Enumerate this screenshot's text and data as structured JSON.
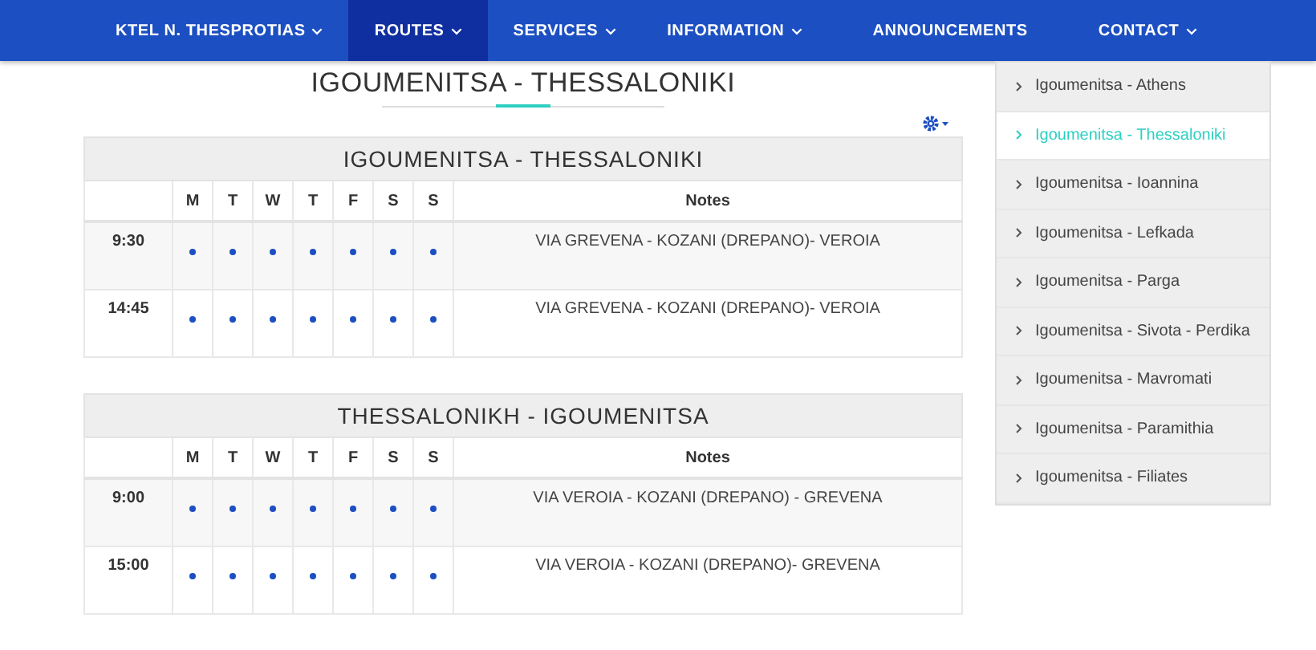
{
  "nav": [
    {
      "label": "KTEL N. THESPROTIAS",
      "dropdown": true,
      "selected": false
    },
    {
      "label": "ROUTES",
      "dropdown": true,
      "selected": true
    },
    {
      "label": "SERVICES",
      "dropdown": true,
      "selected": false
    },
    {
      "label": "INFORMATION",
      "dropdown": true,
      "selected": false
    },
    {
      "label": "ANNOUNCEMENTS",
      "dropdown": false,
      "selected": false
    },
    {
      "label": "CONTACT",
      "dropdown": true,
      "selected": false
    }
  ],
  "page_title": "IGOUMENITSA - THESSALONIKI",
  "timetables": [
    {
      "title": "IGOUMENITSA - THESSALONIKI",
      "days": [
        "M",
        "T",
        "W",
        "T",
        "F",
        "S",
        "S"
      ],
      "notes_header": "Notes",
      "rows": [
        {
          "time": "9:30",
          "runs": [
            true,
            true,
            true,
            true,
            true,
            true,
            true
          ],
          "notes": "VIA GREVENA - KOZANI (DREPANO)- VEROIA"
        },
        {
          "time": "14:45",
          "runs": [
            true,
            true,
            true,
            true,
            true,
            true,
            true
          ],
          "notes": "VIA GREVENA - KOZANI (DREPANO)- VEROIA"
        }
      ]
    },
    {
      "title": "THESSALONIKH - IGOUMENITSA",
      "days": [
        "M",
        "T",
        "W",
        "T",
        "F",
        "S",
        "S"
      ],
      "notes_header": "Notes",
      "rows": [
        {
          "time": "9:00",
          "runs": [
            true,
            true,
            true,
            true,
            true,
            true,
            true
          ],
          "notes": "VIA VEROIA - KOZANI (DREPANO) - GREVENA"
        },
        {
          "time": "15:00",
          "runs": [
            true,
            true,
            true,
            true,
            true,
            true,
            true
          ],
          "notes": "VIA VEROIA - KOZANI (DREPANO)- GREVENA"
        }
      ]
    }
  ],
  "sidebar": {
    "items": [
      {
        "label": "Igoumenitsa - Athens",
        "selected": false
      },
      {
        "label": "Igoumenitsa - Thessaloniki",
        "selected": true
      },
      {
        "label": "Igoumenitsa - Ioannina",
        "selected": false
      },
      {
        "label": "Igoumenitsa - Lefkada",
        "selected": false
      },
      {
        "label": "Igoumenitsa - Parga",
        "selected": false
      },
      {
        "label": "Igoumenitsa - Sivota - Perdika",
        "selected": false
      },
      {
        "label": "Igoumenitsa - Mavromati",
        "selected": false
      },
      {
        "label": "Igoumenitsa - Paramithia",
        "selected": false
      },
      {
        "label": "Igoumenitsa - Filiates",
        "selected": false
      }
    ]
  }
}
